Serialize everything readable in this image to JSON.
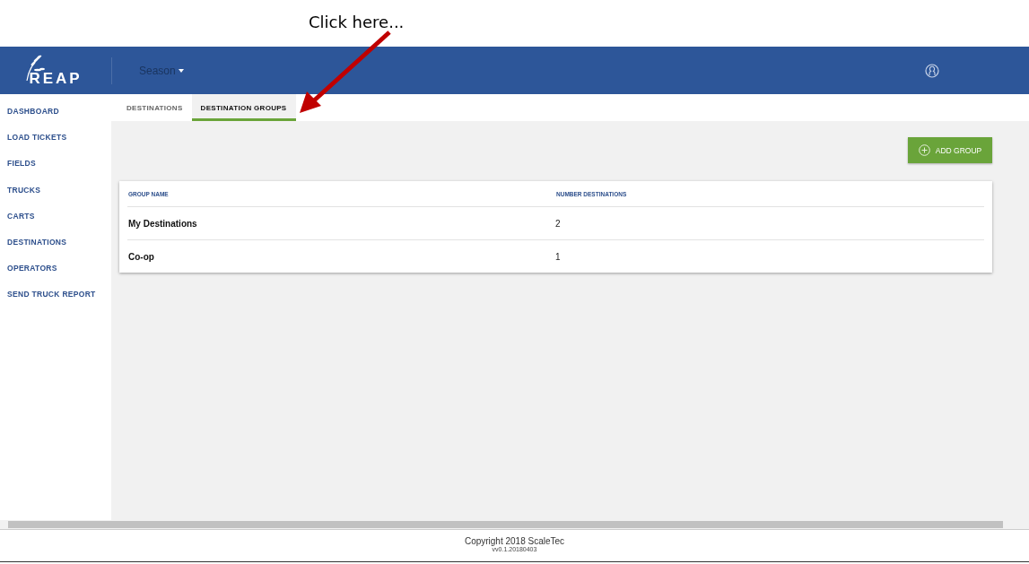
{
  "annotation": {
    "text": "Click here..."
  },
  "header": {
    "logo": "REAP",
    "season": "Season"
  },
  "sidebar": {
    "items": [
      {
        "label": "DASHBOARD"
      },
      {
        "label": "LOAD TICKETS"
      },
      {
        "label": "FIELDS"
      },
      {
        "label": "TRUCKS"
      },
      {
        "label": "CARTS"
      },
      {
        "label": "DESTINATIONS"
      },
      {
        "label": "OPERATORS"
      },
      {
        "label": "SEND TRUCK REPORT"
      }
    ]
  },
  "tabs": [
    {
      "label": "DESTINATIONS",
      "selected": false
    },
    {
      "label": "DESTINATION GROUPS",
      "selected": true
    }
  ],
  "add_button": "ADD GROUP",
  "table": {
    "columns": [
      "GROUP NAME",
      "NUMBER DESTINATIONS"
    ],
    "rows": [
      [
        "My Destinations",
        "2"
      ],
      [
        "Co-op",
        "1"
      ]
    ]
  },
  "footer": {
    "copyright": "Copyright 2018 ScaleTec",
    "version": "vv0.1.20180403"
  }
}
